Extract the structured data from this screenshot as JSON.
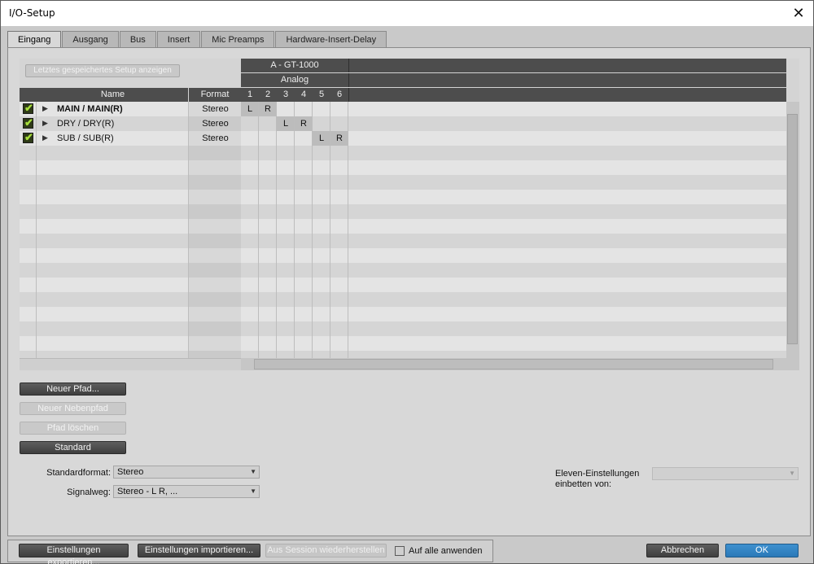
{
  "window": {
    "title": "I/O-Setup"
  },
  "tabs": [
    "Eingang",
    "Ausgang",
    "Bus",
    "Insert",
    "Mic Preamps",
    "Hardware-Insert-Delay"
  ],
  "left_table": {
    "last_setup_button": "Letztes gespeichertes Setup anzeigen",
    "headers": {
      "name": "Name",
      "format": "Format"
    },
    "rows": [
      {
        "name": "MAIN / MAIN(R)",
        "format": "Stereo",
        "checked": true,
        "bold": true
      },
      {
        "name": "DRY / DRY(R)",
        "format": "Stereo",
        "checked": true,
        "bold": false
      },
      {
        "name": "SUB / SUB(R)",
        "format": "Stereo",
        "checked": true,
        "bold": false
      }
    ]
  },
  "grid": {
    "device": "A - GT-1000",
    "group": "Analog",
    "channels": [
      "1",
      "2",
      "3",
      "4",
      "5",
      "6"
    ],
    "assignments": [
      {
        "row": 0,
        "channels": [
          {
            "ch": 0,
            "label": "L"
          },
          {
            "ch": 1,
            "label": "R"
          }
        ]
      },
      {
        "row": 1,
        "channels": [
          {
            "ch": 2,
            "label": "L"
          },
          {
            "ch": 3,
            "label": "R"
          }
        ]
      },
      {
        "row": 2,
        "channels": [
          {
            "ch": 4,
            "label": "L"
          },
          {
            "ch": 5,
            "label": "R"
          }
        ]
      }
    ]
  },
  "path_buttons": {
    "new_path": "Neuer Pfad...",
    "new_subpath": "Neuer Nebenpfad",
    "delete_path": "Pfad löschen",
    "default": "Standard"
  },
  "settings": {
    "default_format_label": "Standardformat:",
    "default_format_value": "Stereo",
    "signal_path_label": "Signalweg:",
    "signal_path_value": "Stereo - L R, ...",
    "eleven_label_line1": "Eleven-Einstellungen",
    "eleven_label_line2": "einbetten von:",
    "eleven_value": ""
  },
  "bottom": {
    "export": "Einstellungen exportieren...",
    "import": "Einstellungen importieren...",
    "restore": "Aus Session wiederherstellen",
    "apply_all": "Auf alle anwenden",
    "cancel": "Abbrechen",
    "ok": "OK"
  }
}
